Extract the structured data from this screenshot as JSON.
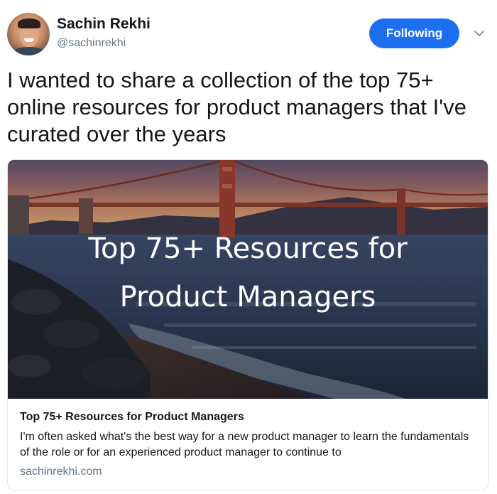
{
  "tweet": {
    "author": {
      "display_name": "Sachin Rekhi",
      "handle": "@sachinrekhi"
    },
    "follow_button_label": "Following",
    "text": "I wanted to share a collection of the top 75+ online resources for product managers that I've curated over the years",
    "card": {
      "image_overlay_line1": "Top 75+ Resources for",
      "image_overlay_line2": "Product Managers",
      "title": "Top 75+ Resources for Product Managers",
      "description": "I'm often asked what's the best way for a new product manager to learn the fundamentals of the role or for an experienced product manager to continue to",
      "domain": "sachinrekhi.com"
    }
  },
  "icons": {
    "menu_caret": "chevron-down-icon",
    "avatar": "profile-photo"
  },
  "colors": {
    "accent": "#1d6ff2",
    "text_primary": "#14171a",
    "text_secondary": "#657786",
    "border": "#e1e8ed"
  }
}
